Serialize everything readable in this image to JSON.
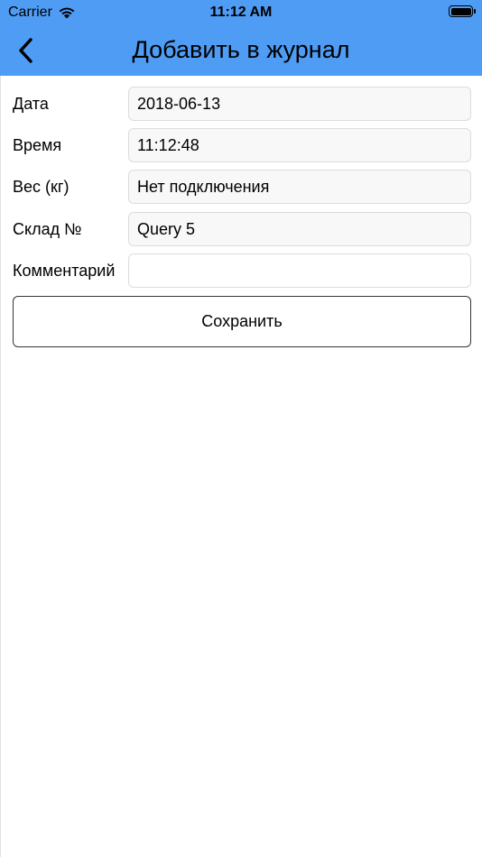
{
  "status_bar": {
    "carrier": "Carrier",
    "time": "11:12 AM",
    "wifi_icon": "wifi-icon",
    "battery_icon": "battery-icon"
  },
  "nav": {
    "title": "Добавить в журнал",
    "back_icon": "chevron-left-icon",
    "background_color": "#4f9cf4"
  },
  "form": {
    "date": {
      "label": "Дата",
      "value": "2018-06-13"
    },
    "time": {
      "label": "Время",
      "value": "11:12:48"
    },
    "weight": {
      "label": "Вес (кг)",
      "value": "Нет подключения"
    },
    "warehouse": {
      "label": "Склад №",
      "value": "Query 5"
    },
    "comment": {
      "label": "Комментарий",
      "value": ""
    }
  },
  "save_button": {
    "label": "Сохранить"
  }
}
